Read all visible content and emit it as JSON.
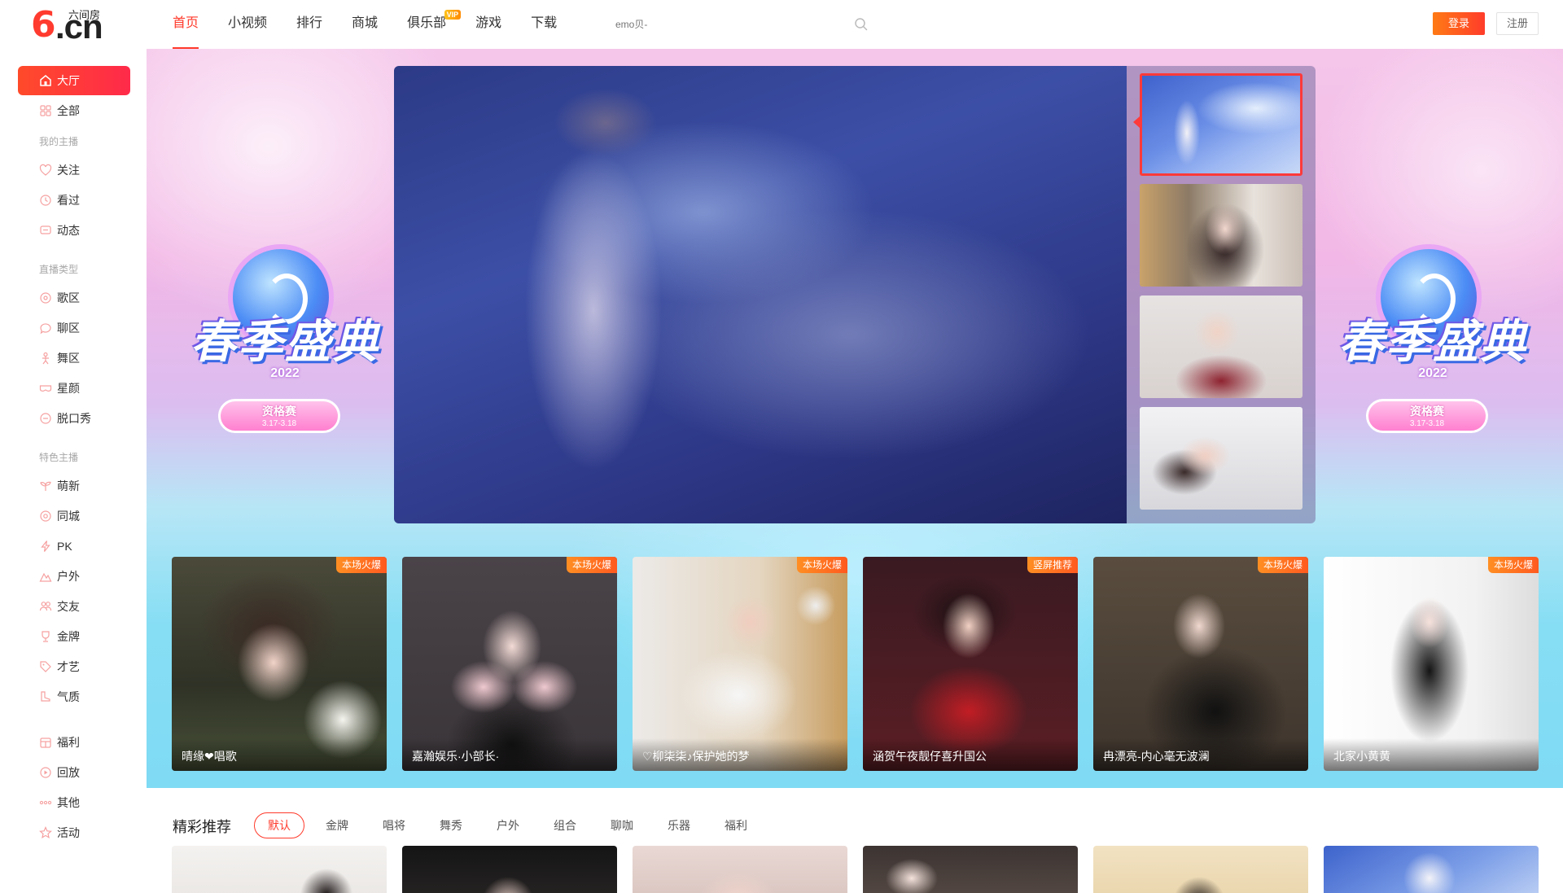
{
  "header": {
    "logo_top": "六间房",
    "logo_dot": ".cn",
    "logo_six": "6",
    "nav": [
      {
        "label": "首页",
        "active": true
      },
      {
        "label": "小视频"
      },
      {
        "label": "排行"
      },
      {
        "label": "商城"
      },
      {
        "label": "俱乐部",
        "badge": "VIP"
      },
      {
        "label": "游戏"
      },
      {
        "label": "下载"
      }
    ],
    "search_placeholder": "emo贝-",
    "login_label": "登录",
    "register_label": "注册",
    "accent": "#ff3a2b"
  },
  "sidebar": {
    "hall": "大厅",
    "all": "全部",
    "heading_my": "我的主播",
    "follow": "关注",
    "watched": "看过",
    "moments": "动态",
    "heading_type": "直播类型",
    "song": "歌区",
    "chat": "聊区",
    "dance": "舞区",
    "star": "星颜",
    "talk": "脱口秀",
    "heading_feature": "特色主播",
    "newbie": "萌新",
    "city": "同城",
    "pk": "PK",
    "outdoor": "户外",
    "friends": "交友",
    "gold": "金牌",
    "talent": "才艺",
    "temper": "气质",
    "welfare": "福利",
    "replay": "回放",
    "other": "其他",
    "activity": "活动"
  },
  "banner": {
    "festival_title": "春季盛典",
    "festival_year": "2022",
    "festival_pill": "资格赛",
    "festival_dates": "3.17-3.18"
  },
  "cards": [
    {
      "tag": "本场火爆",
      "name": "晴缘❤唱歌"
    },
    {
      "tag": "本场火爆",
      "name": "嘉瀚娱乐·小部长·"
    },
    {
      "tag": "本场火爆",
      "name": "♡柳柒柒♪保护她的梦"
    },
    {
      "tag": "竖屏推荐",
      "name": "涵贺午夜靓仔喜升国公"
    },
    {
      "tag": "本场火爆",
      "name": "冉漂亮-内心毫无波澜"
    },
    {
      "tag": "本场火爆",
      "name": "北家小黄黄"
    }
  ],
  "recommend": {
    "title": "精彩推荐",
    "tabs": [
      "默认",
      "金牌",
      "唱将",
      "舞秀",
      "户外",
      "组合",
      "聊咖",
      "乐器",
      "福利"
    ]
  }
}
